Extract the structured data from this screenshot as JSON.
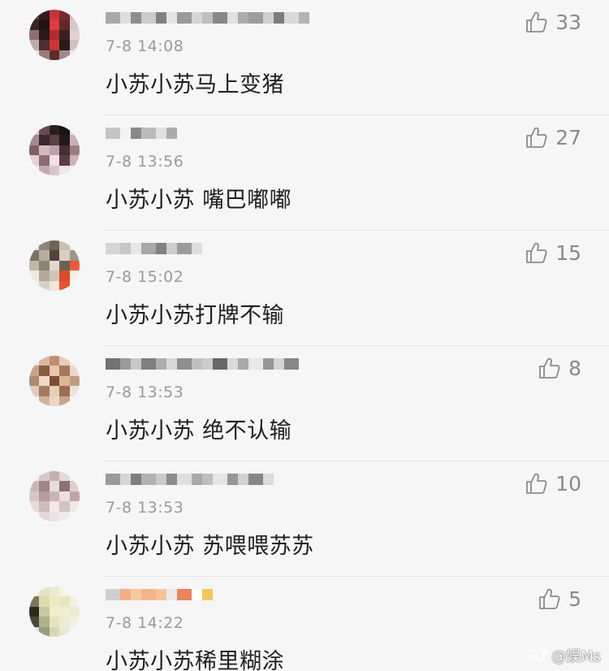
{
  "comments": [
    {
      "time": "7-8 14:08",
      "text": "小苏小苏马上变猪",
      "likes": "33",
      "avatar": [
        "#5a3a3a",
        "#2d1d1d",
        "#c8323a",
        "#7a2a2a",
        "#c9b8b8",
        "#3d2424",
        "#1e1414",
        "#e23b3b",
        "#5c2b2b",
        "#d8c8c8",
        "#8c6f6f",
        "#2a1a1a",
        "#b52a30",
        "#3a2020",
        "#e0d2d2",
        "#bfaaaa",
        "#4a3030",
        "#d03236",
        "#2a1c1c",
        "#cfc0c0",
        "#ebe0e0",
        "#9a7c7c",
        "#5b2d2d",
        "#a48989",
        "#f0e8e8"
      ],
      "name_blocks": [
        "#9a9a9a",
        "#d8d8d8",
        "#7a7a7a",
        "#c4c4c4",
        "#6c6c6c",
        "#e0e0e0",
        "#888888",
        "#cfcfcf",
        "#b5b5b5",
        "#737373",
        "#dcdcdc",
        "#9e9e9e",
        "#8d8d8d",
        "#c8c8c8",
        "#666666",
        "#d4d4d4",
        "#a7a7a7"
      ]
    },
    {
      "time": "7-8 13:56",
      "text": "小苏小苏 嘴巴嘟嘟",
      "likes": "27",
      "avatar": [
        "#d8c8cc",
        "#6a4b52",
        "#2c1e22",
        "#1a1215",
        "#e6dcdf",
        "#a68890",
        "#3a2a2e",
        "#5e4048",
        "#221a1c",
        "#c9b3b8",
        "#7f5f67",
        "#d8b8c0",
        "#bfa2a9",
        "#442f35",
        "#9a7d84",
        "#e2d4d7",
        "#8a6c74",
        "#f0e2e6",
        "#5a3d44",
        "#cab2b8",
        "#f2eaec",
        "#c4aab0",
        "#d7c6ca",
        "#efe6e8",
        "#f6f1f2"
      ],
      "name_blocks": [
        "#bcbcbc",
        "#f2f2f2",
        "#777777",
        "#b0b0b0",
        "#dcdcdc",
        "#9f9f9f"
      ]
    },
    {
      "time": "7-8 15:02",
      "text": "小苏小苏打牌不输",
      "likes": "15",
      "avatar": [
        "#e6e2dc",
        "#8c8478",
        "#6e6558",
        "#c8c0b4",
        "#ece8e2",
        "#7a7264",
        "#b8ad9e",
        "#4e463c",
        "#d6cec2",
        "#a09686",
        "#c0b6a8",
        "#8e8474",
        "#e0d8cc",
        "#6c6252",
        "#e85a3a",
        "#efe9e2",
        "#b4aa9a",
        "#cfc6b8",
        "#dd4a2c",
        "#f4efe8",
        "#f3efea",
        "#d8d0c4",
        "#ede6dd",
        "#e9542f",
        "#f7f3ee"
      ],
      "name_blocks": [
        "#cfcfcf",
        "#bdbdbd",
        "#e4e4e4",
        "#9a9a9a",
        "#6c6c6c",
        "#c6c6c6",
        "#8b8b8b",
        "#d8d8d8"
      ]
    },
    {
      "time": "7-8 13:53",
      "text": "小苏小苏 绝不认输",
      "likes": "8",
      "avatar": [
        "#efe4dc",
        "#d8b8a0",
        "#c09070",
        "#e4cdbc",
        "#f4ece6",
        "#c8a28a",
        "#8a5a40",
        "#e8c4a8",
        "#a8785a",
        "#ead8ca",
        "#b08a74",
        "#f0d8c4",
        "#7a4e36",
        "#dcb496",
        "#c49a80",
        "#e0cab8",
        "#a47a62",
        "#e8cdb6",
        "#9c6e54",
        "#efe2d8",
        "#f5eee8",
        "#d2b29c",
        "#e9d6c6",
        "#c9a58d",
        "#f8f2ee"
      ],
      "name_blocks": [
        "#5a5a5a",
        "#8a8a8a",
        "#bfbfbf",
        "#6a6a6a",
        "#a0a0a0",
        "#d2d2d2",
        "#7c7c7c",
        "#b6b6b6",
        "#c4c4c4",
        "#4e4e4e",
        "#d6d6d6",
        "#9c9c9c",
        "#e6e6e6",
        "#858585",
        "#cdcdcd",
        "#727272"
      ]
    },
    {
      "time": "7-8 13:53",
      "text": "小苏小苏 苏喂喂苏苏",
      "likes": "10",
      "avatar": [
        "#f0eaea",
        "#d6c8c8",
        "#c2b0b0",
        "#e4d8d8",
        "#f4f0f0",
        "#cbb8b8",
        "#a08686",
        "#e8dcdc",
        "#8e7272",
        "#ddd0d0",
        "#d8c6c6",
        "#b89c9c",
        "#c9b4b4",
        "#eadede",
        "#bda4a4",
        "#e6dada",
        "#ccbcbc",
        "#f1e8e8",
        "#d4c2c2",
        "#efe6e6",
        "#f6f2f2",
        "#e2d6d6",
        "#ebe2e2",
        "#f0e9e9",
        "#f8f5f5"
      ],
      "name_blocks": [
        "#8a8a8a",
        "#d0d0d0",
        "#6a6a6a",
        "#a6a6a6",
        "#c2c2c2",
        "#787878",
        "#dadada",
        "#9a9a9a",
        "#b4b4b4",
        "#e2e2e2",
        "#868686",
        "#cacaca",
        "#727272",
        "#d6d6d6"
      ]
    },
    {
      "time": "7-8 14:22",
      "text": "小苏小苏稀里糊涂",
      "likes": "5",
      "avatar": [
        "#f0f0e4",
        "#e2e2c8",
        "#ecebd0",
        "#f4f4e8",
        "#f6f6ee",
        "#7a7a5a",
        "#dcdcb0",
        "#ecec c4",
        "#e8e6be",
        "#f2f2e2",
        "#2a2a20",
        "#c8c8a0",
        "#eeeec8",
        "#f0eed2",
        "#ebebd4",
        "#4a4a38",
        "#b0b08a",
        "#e4e4c0",
        "#ececd2",
        "#f0f0e0",
        "#dcdcd0",
        "#9a9a7c",
        "#d8d8b8",
        "#e8e8d4",
        "#f4f4ec"
      ],
      "name_blocks": [
        "#c8c8c8",
        "#f4a070",
        "#f8c090",
        "#f0a878",
        "#f6b88c",
        "#e8e8e8",
        "#e87040",
        "#ffffff",
        "#f0c040"
      ]
    }
  ],
  "watermark": {
    "text": "@娱Ms"
  },
  "colors": {
    "background": "#f6f6f6",
    "text": "#1f1f1f",
    "meta": "#9a9a9a",
    "like": "#8a8a8a",
    "separator": "#e2e2e2"
  },
  "icons": {
    "like": "thumbs-up-icon",
    "weibo": "weibo-icon"
  }
}
